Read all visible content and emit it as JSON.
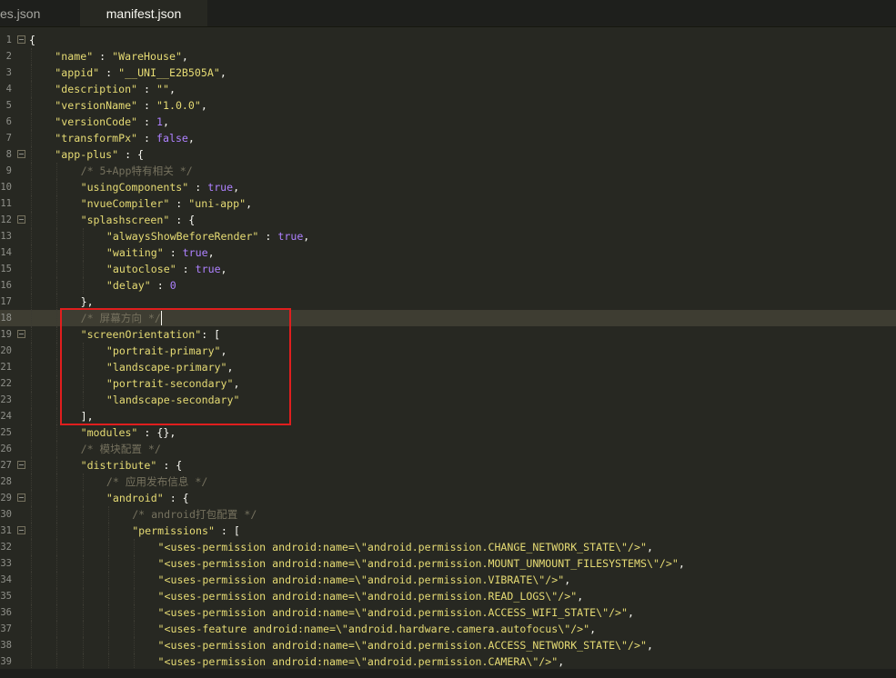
{
  "tabs": [
    {
      "label": "es.json",
      "active": false
    },
    {
      "label": "manifest.json",
      "active": true
    }
  ],
  "editor": {
    "current_line": 18,
    "lines": [
      {
        "n": "1",
        "fold": true,
        "indent": 0,
        "tokens": [
          [
            "p",
            "{"
          ]
        ]
      },
      {
        "n": "2",
        "indent": 1,
        "tokens": [
          [
            "s",
            "\"name\""
          ],
          [
            "p",
            " : "
          ],
          [
            "s",
            "\"WareHouse\""
          ],
          [
            "p",
            ","
          ]
        ]
      },
      {
        "n": "3",
        "indent": 1,
        "tokens": [
          [
            "s",
            "\"appid\""
          ],
          [
            "p",
            " : "
          ],
          [
            "s",
            "\"__UNI__E2B505A\""
          ],
          [
            "p",
            ","
          ]
        ]
      },
      {
        "n": "4",
        "indent": 1,
        "tokens": [
          [
            "s",
            "\"description\""
          ],
          [
            "p",
            " : "
          ],
          [
            "s",
            "\"\""
          ],
          [
            "p",
            ","
          ]
        ]
      },
      {
        "n": "5",
        "indent": 1,
        "tokens": [
          [
            "s",
            "\"versionName\""
          ],
          [
            "p",
            " : "
          ],
          [
            "s",
            "\"1.0.0\""
          ],
          [
            "p",
            ","
          ]
        ]
      },
      {
        "n": "6",
        "indent": 1,
        "tokens": [
          [
            "s",
            "\"versionCode\""
          ],
          [
            "p",
            " : "
          ],
          [
            "n",
            "1"
          ],
          [
            "p",
            ","
          ]
        ]
      },
      {
        "n": "7",
        "indent": 1,
        "tokens": [
          [
            "s",
            "\"transformPx\""
          ],
          [
            "p",
            " : "
          ],
          [
            "k",
            "false"
          ],
          [
            "p",
            ","
          ]
        ]
      },
      {
        "n": "8",
        "fold": true,
        "indent": 1,
        "tokens": [
          [
            "s",
            "\"app-plus\""
          ],
          [
            "p",
            " : {"
          ]
        ]
      },
      {
        "n": "9",
        "indent": 2,
        "tokens": [
          [
            "c",
            "/* 5+App特有相关 */"
          ]
        ]
      },
      {
        "n": "10",
        "indent": 2,
        "tokens": [
          [
            "s",
            "\"usingComponents\""
          ],
          [
            "p",
            " : "
          ],
          [
            "k",
            "true"
          ],
          [
            "p",
            ","
          ]
        ]
      },
      {
        "n": "11",
        "indent": 2,
        "tokens": [
          [
            "s",
            "\"nvueCompiler\""
          ],
          [
            "p",
            " : "
          ],
          [
            "s",
            "\"uni-app\""
          ],
          [
            "p",
            ","
          ]
        ]
      },
      {
        "n": "12",
        "fold": true,
        "indent": 2,
        "tokens": [
          [
            "s",
            "\"splashscreen\""
          ],
          [
            "p",
            " : {"
          ]
        ]
      },
      {
        "n": "13",
        "indent": 3,
        "tokens": [
          [
            "s",
            "\"alwaysShowBeforeRender\""
          ],
          [
            "p",
            " : "
          ],
          [
            "k",
            "true"
          ],
          [
            "p",
            ","
          ]
        ]
      },
      {
        "n": "14",
        "indent": 3,
        "tokens": [
          [
            "s",
            "\"waiting\""
          ],
          [
            "p",
            " : "
          ],
          [
            "k",
            "true"
          ],
          [
            "p",
            ","
          ]
        ]
      },
      {
        "n": "15",
        "indent": 3,
        "tokens": [
          [
            "s",
            "\"autoclose\""
          ],
          [
            "p",
            " : "
          ],
          [
            "k",
            "true"
          ],
          [
            "p",
            ","
          ]
        ]
      },
      {
        "n": "16",
        "indent": 3,
        "tokens": [
          [
            "s",
            "\"delay\""
          ],
          [
            "p",
            " : "
          ],
          [
            "n",
            "0"
          ]
        ]
      },
      {
        "n": "17",
        "indent": 2,
        "tokens": [
          [
            "p",
            "},"
          ]
        ]
      },
      {
        "n": "18",
        "indent": 2,
        "tokens": [
          [
            "c",
            "/* 屏幕方向 */"
          ]
        ]
      },
      {
        "n": "19",
        "fold": true,
        "indent": 2,
        "tokens": [
          [
            "s",
            "\"screenOrientation\""
          ],
          [
            "p",
            ": ["
          ]
        ]
      },
      {
        "n": "20",
        "indent": 3,
        "tokens": [
          [
            "s",
            "\"portrait-primary\""
          ],
          [
            "p",
            ","
          ]
        ]
      },
      {
        "n": "21",
        "indent": 3,
        "tokens": [
          [
            "s",
            "\"landscape-primary\""
          ],
          [
            "p",
            ","
          ]
        ]
      },
      {
        "n": "22",
        "indent": 3,
        "tokens": [
          [
            "s",
            "\"portrait-secondary\""
          ],
          [
            "p",
            ","
          ]
        ]
      },
      {
        "n": "23",
        "indent": 3,
        "tokens": [
          [
            "s",
            "\"landscape-secondary\""
          ]
        ]
      },
      {
        "n": "24",
        "indent": 2,
        "tokens": [
          [
            "p",
            "],"
          ]
        ]
      },
      {
        "n": "25",
        "indent": 2,
        "tokens": [
          [
            "s",
            "\"modules\""
          ],
          [
            "p",
            " : {},"
          ]
        ]
      },
      {
        "n": "26",
        "indent": 2,
        "tokens": [
          [
            "c",
            "/* 模块配置 */"
          ]
        ]
      },
      {
        "n": "27",
        "fold": true,
        "indent": 2,
        "tokens": [
          [
            "s",
            "\"distribute\""
          ],
          [
            "p",
            " : {"
          ]
        ]
      },
      {
        "n": "28",
        "indent": 3,
        "tokens": [
          [
            "c",
            "/* 应用发布信息 */"
          ]
        ]
      },
      {
        "n": "29",
        "fold": true,
        "indent": 3,
        "tokens": [
          [
            "s",
            "\"android\""
          ],
          [
            "p",
            " : {"
          ]
        ]
      },
      {
        "n": "30",
        "indent": 4,
        "tokens": [
          [
            "c",
            "/* android打包配置 */"
          ]
        ]
      },
      {
        "n": "31",
        "fold": true,
        "indent": 4,
        "tokens": [
          [
            "s",
            "\"permissions\""
          ],
          [
            "p",
            " : ["
          ]
        ]
      },
      {
        "n": "32",
        "indent": 5,
        "tokens": [
          [
            "s",
            "\"<uses-permission android:name=\\\"android.permission.CHANGE_NETWORK_STATE\\\"/>\""
          ],
          [
            "p",
            ","
          ]
        ]
      },
      {
        "n": "33",
        "indent": 5,
        "tokens": [
          [
            "s",
            "\"<uses-permission android:name=\\\"android.permission.MOUNT_UNMOUNT_FILESYSTEMS\\\"/>\""
          ],
          [
            "p",
            ","
          ]
        ]
      },
      {
        "n": "34",
        "indent": 5,
        "tokens": [
          [
            "s",
            "\"<uses-permission android:name=\\\"android.permission.VIBRATE\\\"/>\""
          ],
          [
            "p",
            ","
          ]
        ]
      },
      {
        "n": "35",
        "indent": 5,
        "tokens": [
          [
            "s",
            "\"<uses-permission android:name=\\\"android.permission.READ_LOGS\\\"/>\""
          ],
          [
            "p",
            ","
          ]
        ]
      },
      {
        "n": "36",
        "indent": 5,
        "tokens": [
          [
            "s",
            "\"<uses-permission android:name=\\\"android.permission.ACCESS_WIFI_STATE\\\"/>\""
          ],
          [
            "p",
            ","
          ]
        ]
      },
      {
        "n": "37",
        "indent": 5,
        "tokens": [
          [
            "s",
            "\"<uses-feature android:name=\\\"android.hardware.camera.autofocus\\\"/>\""
          ],
          [
            "p",
            ","
          ]
        ]
      },
      {
        "n": "38",
        "indent": 5,
        "tokens": [
          [
            "s",
            "\"<uses-permission android:name=\\\"android.permission.ACCESS_NETWORK_STATE\\\"/>\""
          ],
          [
            "p",
            ","
          ]
        ]
      },
      {
        "n": "39",
        "indent": 5,
        "tokens": [
          [
            "s",
            "\"<uses-permission android:name=\\\"android.permission.CAMERA\\\"/>\""
          ],
          [
            "p",
            ","
          ]
        ]
      }
    ]
  },
  "annotation": {
    "color": "#e01e1e",
    "label": "red highlight box around screenOrientation block"
  },
  "colors": {
    "background": "#272822",
    "string": "#e6db74",
    "number": "#ae81ff",
    "comment": "#75715e",
    "current_line": "#3e3d32"
  }
}
